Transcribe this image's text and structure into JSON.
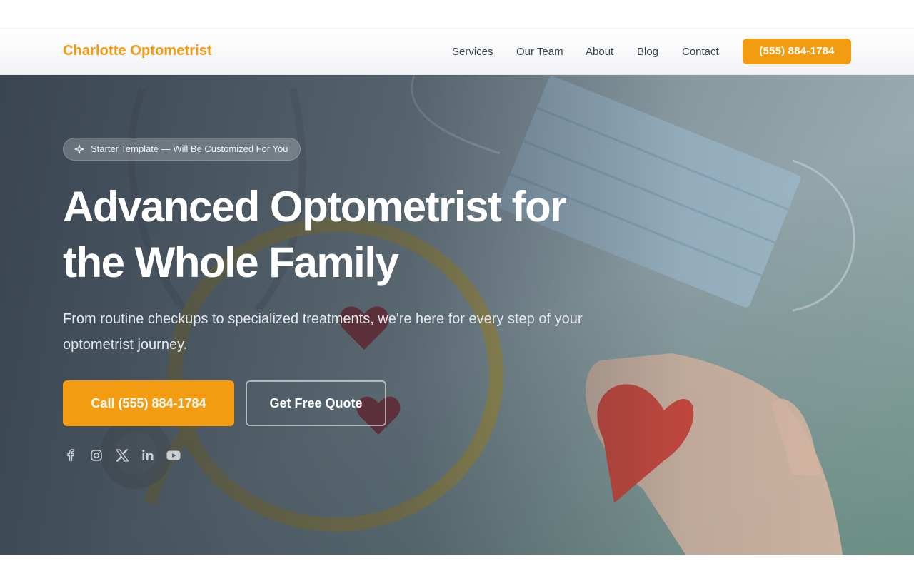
{
  "header": {
    "brand": "Charlotte Optometrist",
    "nav": [
      {
        "label": "Services"
      },
      {
        "label": "Our Team"
      },
      {
        "label": "About"
      },
      {
        "label": "Blog"
      },
      {
        "label": "Contact"
      }
    ],
    "cta_label": "(555) 884-1784"
  },
  "hero": {
    "badge": "Starter Template — Will Be Customized For You",
    "title_line1": "Advanced Optometrist for",
    "title_line2": "the Whole Family",
    "subtitle": "From routine checkups to specialized treatments, we're here for every step of your optometrist journey.",
    "primary_button": "Call (555) 884-1784",
    "secondary_button": "Get Free Quote",
    "social_icons": [
      "facebook-icon",
      "instagram-icon",
      "x-icon",
      "linkedin-icon",
      "youtube-icon"
    ]
  },
  "colors": {
    "accent": "#f39c12",
    "nav_text": "#3b4250",
    "hero_overlay": "#232d3a"
  }
}
